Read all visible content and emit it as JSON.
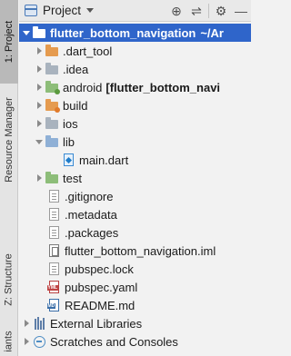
{
  "left_strip": {
    "project_tab": "1: Project",
    "resource_tab": "Resource Manager",
    "structure_tab": "Z: Structure",
    "variants_tab": "iants"
  },
  "header": {
    "view_label": "Project",
    "icons": [
      "locate-icon",
      "collapse-icon",
      "settings-icon",
      "hide-icon"
    ],
    "icon_glyphs": {
      "locate": "⊕",
      "collapse": "⇌",
      "settings": "⚙",
      "hide": "—"
    }
  },
  "tree": {
    "root": {
      "name": "flutter_bottom_navigation",
      "path": "~/Ar"
    },
    "items": [
      {
        "label": ".dart_tool",
        "kind": "folder-orange",
        "expand": "collapsed"
      },
      {
        "label": ".idea",
        "kind": "folder-gray",
        "expand": "collapsed"
      },
      {
        "label": "android",
        "extra": "[flutter_bottom_navi",
        "kind": "folder-green",
        "expand": "collapsed"
      },
      {
        "label": "build",
        "kind": "folder-orange",
        "expand": "collapsed"
      },
      {
        "label": "ios",
        "kind": "folder-gray",
        "expand": "collapsed"
      },
      {
        "label": "lib",
        "kind": "folder-blue",
        "expand": "expanded"
      },
      {
        "label": "main.dart",
        "kind": "file-dart",
        "expand": "none"
      },
      {
        "label": "test",
        "kind": "folder-green",
        "expand": "collapsed"
      },
      {
        "label": ".gitignore",
        "kind": "file-text",
        "expand": "none"
      },
      {
        "label": ".metadata",
        "kind": "file-text",
        "expand": "none"
      },
      {
        "label": ".packages",
        "kind": "file-text",
        "expand": "none"
      },
      {
        "label": "flutter_bottom_navigation.iml",
        "kind": "file-iml",
        "expand": "none"
      },
      {
        "label": "pubspec.lock",
        "kind": "file-text",
        "expand": "none"
      },
      {
        "label": "pubspec.yaml",
        "kind": "file-yml",
        "expand": "none"
      },
      {
        "label": "README.md",
        "kind": "file-md",
        "expand": "none"
      }
    ],
    "external_libraries": "External Libraries",
    "scratches": "Scratches and Consoles"
  },
  "colors": {
    "selection": "#2f65ca",
    "folder_blue": "#8fb0d6",
    "folder_orange": "#e59b4f",
    "folder_green": "#8dbd79"
  }
}
